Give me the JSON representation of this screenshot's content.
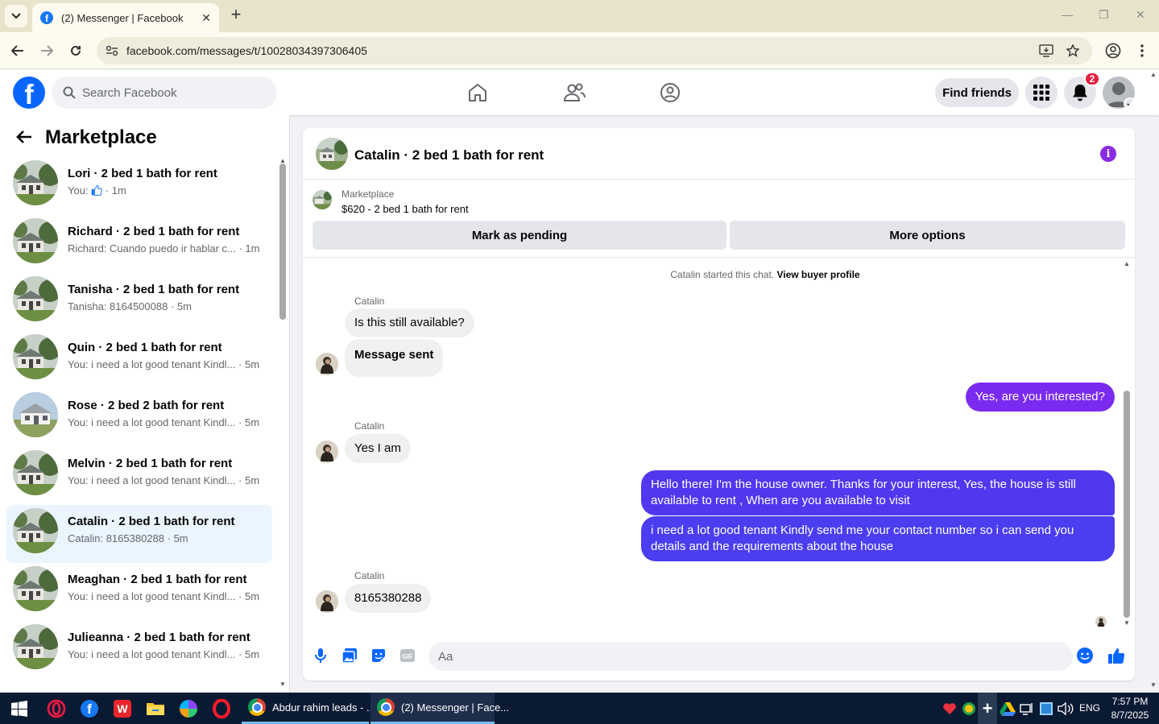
{
  "browser": {
    "tab_title": "(2) Messenger | Facebook",
    "url": "facebook.com/messages/t/10028034397306405"
  },
  "header": {
    "search_placeholder": "Search Facebook",
    "find_friends_label": "Find friends",
    "notification_count": "2"
  },
  "sidebar": {
    "title": "Marketplace",
    "conversations": [
      {
        "name": "Lori · 2 bed 1 bath for rent",
        "preview": "You:",
        "preview_icon": "thumbs-up-icon",
        "time": "· 1m"
      },
      {
        "name": "Richard · 2 bed 1 bath for rent",
        "preview": "Richard: Cuando puedo ir hablar c...",
        "time": "· 1m"
      },
      {
        "name": "Tanisha · 2 bed 1 bath for rent",
        "preview": "Tanisha: 8164500088",
        "time": "· 5m"
      },
      {
        "name": "Quin · 2 bed 1 bath for rent",
        "preview": "You: i need a lot good tenant Kindl...",
        "time": "· 5m"
      },
      {
        "name": "Rose · 2 bed 2 bath for rent",
        "preview": "You: i need a lot good tenant Kindl...",
        "time": "· 5m"
      },
      {
        "name": "Melvin · 2 bed 1 bath for rent",
        "preview": "You: i need a lot good tenant Kindl...",
        "time": "· 5m"
      },
      {
        "name": "Catalin · 2 bed 1 bath for rent",
        "preview": "Catalin: 8165380288",
        "time": "· 5m",
        "active": true
      },
      {
        "name": "Meaghan · 2 bed 1 bath for rent",
        "preview": "You: i need a lot good tenant Kindl...",
        "time": "· 5m"
      },
      {
        "name": "Julieanna · 2 bed 1 bath for rent",
        "preview": "You: i need a lot good tenant Kindl...",
        "time": "· 5m"
      }
    ]
  },
  "chat": {
    "title": "Catalin · 2 bed 1 bath for rent",
    "listing": {
      "kicker": "Marketplace",
      "price_title": "$620 - 2 bed 1 bath for rent",
      "mark_pending_label": "Mark as pending",
      "more_options_label": "More options"
    },
    "system_text": "Catalin started this chat.",
    "system_link": "View buyer profile",
    "messages": [
      {
        "from": "Catalin",
        "text": "Is this still available?"
      },
      {
        "from": "Catalin",
        "text": "Message sent"
      },
      {
        "from": "me",
        "text": "Yes, are you interested?"
      },
      {
        "from": "Catalin",
        "text": "Yes I am"
      },
      {
        "from": "me",
        "text": "Hello there! I'm the house owner. Thanks for your interest, Yes, the house is still available to rent , When are you available to visit"
      },
      {
        "from": "me",
        "text": "i need a lot good tenant Kindly send me your contact number so i can send you details and the requirements about the house"
      },
      {
        "from": "Catalin",
        "text": "8165380288"
      }
    ],
    "composer_placeholder": "Aa"
  },
  "taskbar": {
    "apps": [
      {
        "label": "Abdur rahim leads - ..."
      },
      {
        "label": "(2) Messenger | Face..."
      }
    ],
    "language": "ENG",
    "time": "7:57 PM",
    "date": "8/7/2025"
  },
  "colors": {
    "facebook_blue": "#0866ff",
    "outgoing_purple": "#7b2bf0",
    "outgoing_blue": "#4b3ef0",
    "active_conversation": "#ebf5ff"
  }
}
